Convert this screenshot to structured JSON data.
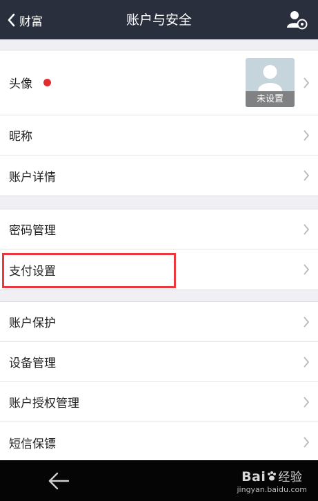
{
  "header": {
    "back_label": "财富",
    "title": "账户与安全",
    "settings_icon": "user-settings-icon"
  },
  "groups": [
    {
      "items": [
        {
          "label": "头像",
          "badge": "red-dot",
          "avatar_caption": "未设置"
        },
        {
          "label": "昵称"
        },
        {
          "label": "账户详情"
        }
      ]
    },
    {
      "items": [
        {
          "label": "密码管理"
        },
        {
          "label": "支付设置",
          "highlighted": true
        }
      ]
    },
    {
      "items": [
        {
          "label": "账户保护"
        },
        {
          "label": "设备管理"
        },
        {
          "label": "账户授权管理"
        },
        {
          "label": "短信保镖"
        }
      ]
    }
  ],
  "bottom_bar": {
    "back_icon": "back-arrow-icon",
    "watermark_logo_left": "Bai",
    "watermark_logo_right": "经验",
    "watermark_url": "jingyan.baidu.com"
  },
  "colors": {
    "header_bg": "#2a2f3d",
    "highlight": "#e8383d",
    "badge": "#e02e2e",
    "background": "#efeff4"
  }
}
